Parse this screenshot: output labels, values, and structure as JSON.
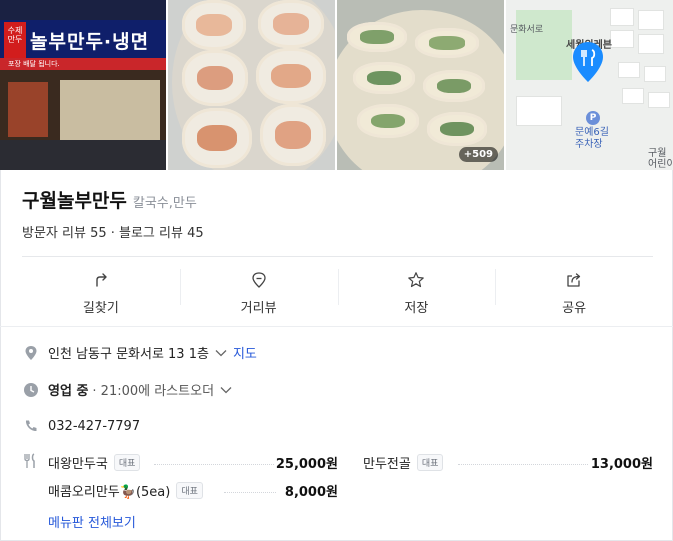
{
  "photos": {
    "storefront": {
      "sign_text": "놀부만두·냉면",
      "red_sign_text": "수제만두",
      "strip_text": "포장 배달 됩니다."
    },
    "more_count": "+509",
    "map": {
      "restaurant_label": "세월의레븐",
      "parking_label": "문예6길\n주차장",
      "parking_icon": "P",
      "road_label": "구월\n어린이",
      "street_label": "문화서로"
    }
  },
  "place": {
    "name": "구월놀부만두",
    "category": "칼국수,만두",
    "reviews": "방문자 리뷰 55 · 블로그 리뷰 45"
  },
  "actions": [
    {
      "label": "길찾기",
      "icon": "directions-icon"
    },
    {
      "label": "거리뷰",
      "icon": "streetview-icon"
    },
    {
      "label": "저장",
      "icon": "star-icon"
    },
    {
      "label": "공유",
      "icon": "share-icon"
    }
  ],
  "info": {
    "address": "인천 남동구 문화서로 13 1층",
    "map_link": "지도",
    "hours_status": "영업 중",
    "hours_detail": "· 21:00에 라스트오더",
    "phone": "032-427-7797"
  },
  "menu": {
    "items": [
      {
        "name": "대왕만두국",
        "badge": "대표",
        "price": "25,000원"
      },
      {
        "name": "만두전골",
        "badge": "대표",
        "price": "13,000원"
      },
      {
        "name": "매콤오리만두🦆(5ea)",
        "badge": "대표",
        "price": "8,000원"
      }
    ],
    "more_label": "메뉴판 전체보기"
  },
  "colors": {
    "accent_blue": "#2658d9",
    "pin_blue": "#1a8cff"
  }
}
